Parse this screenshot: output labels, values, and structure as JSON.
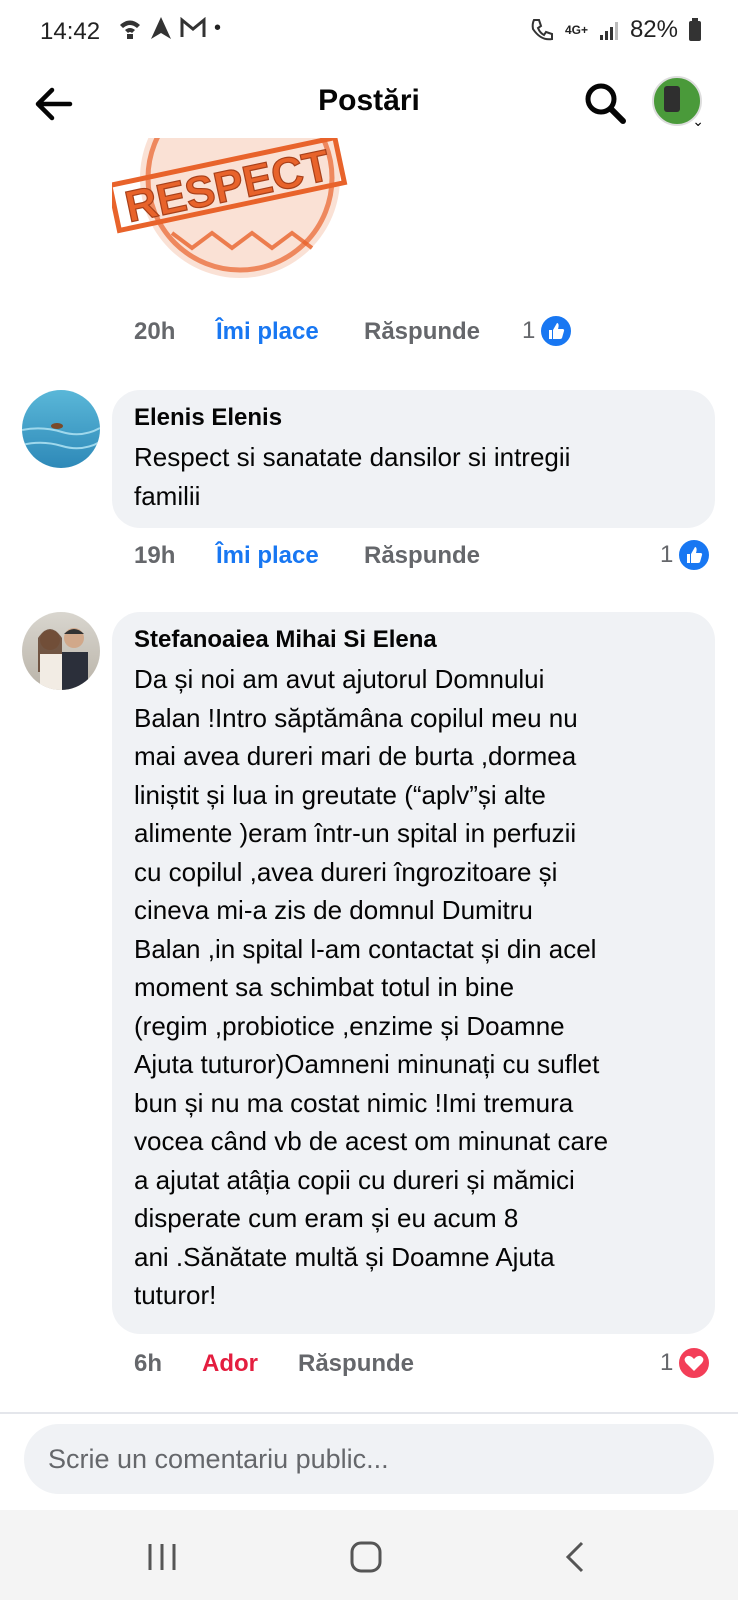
{
  "status_bar": {
    "time": "14:42",
    "network": "4G+",
    "battery": "82%"
  },
  "header": {
    "title": "Postări"
  },
  "sticker": {
    "text": "RESPECT",
    "color": "#e8632b"
  },
  "comments": [
    {
      "time": "20h",
      "reaction_label": "Îmi place",
      "reply_label": "Răspunde",
      "reaction_count": "1",
      "reaction_type": "like"
    },
    {
      "author": "Elenis Elenis",
      "text": "Respect si sanatate dansilor si intregii\nfamilii",
      "time": "19h",
      "reaction_label": "Îmi place",
      "reply_label": "Răspunde",
      "reaction_count": "1",
      "reaction_type": "like"
    },
    {
      "author": "Stefanoaiea Mihai Si Elena",
      "text": "Da și noi am avut ajutorul Domnului\nBalan !Intro săptămâna copilul meu nu\nmai avea dureri mari de burta ,dormea\nliniștit și lua in greutate (“aplv”și alte\nalimente )eram într-un spital in perfuzii\ncu copilul ,avea dureri îngrozitoare și\ncineva mi-a zis de domnul Dumitru\nBalan ,in spital l-am contactat și din acel\nmoment sa schimbat totul in bine\n(regim ,probiotice ,enzime și Doamne\nAjuta tuturor)Oamneni minunați cu suflet\nbun și nu ma costat nimic !Imi tremura\nvocea când vb de acest om minunat care\na ajutat atâția copii cu dureri și mămici\ndisperate cum eram și eu acum 8\nani .Sănătate multă și Doamne Ajuta\ntuturor!",
      "time": "6h",
      "reaction_label": "Ador",
      "reply_label": "Răspunde",
      "reaction_count": "1",
      "reaction_type": "love"
    }
  ],
  "composer": {
    "placeholder": "Scrie un comentariu public..."
  },
  "colors": {
    "like": "#1877f2",
    "love": "#e41e3f",
    "bubble": "#f0f2f5",
    "meta": "#65676b"
  }
}
